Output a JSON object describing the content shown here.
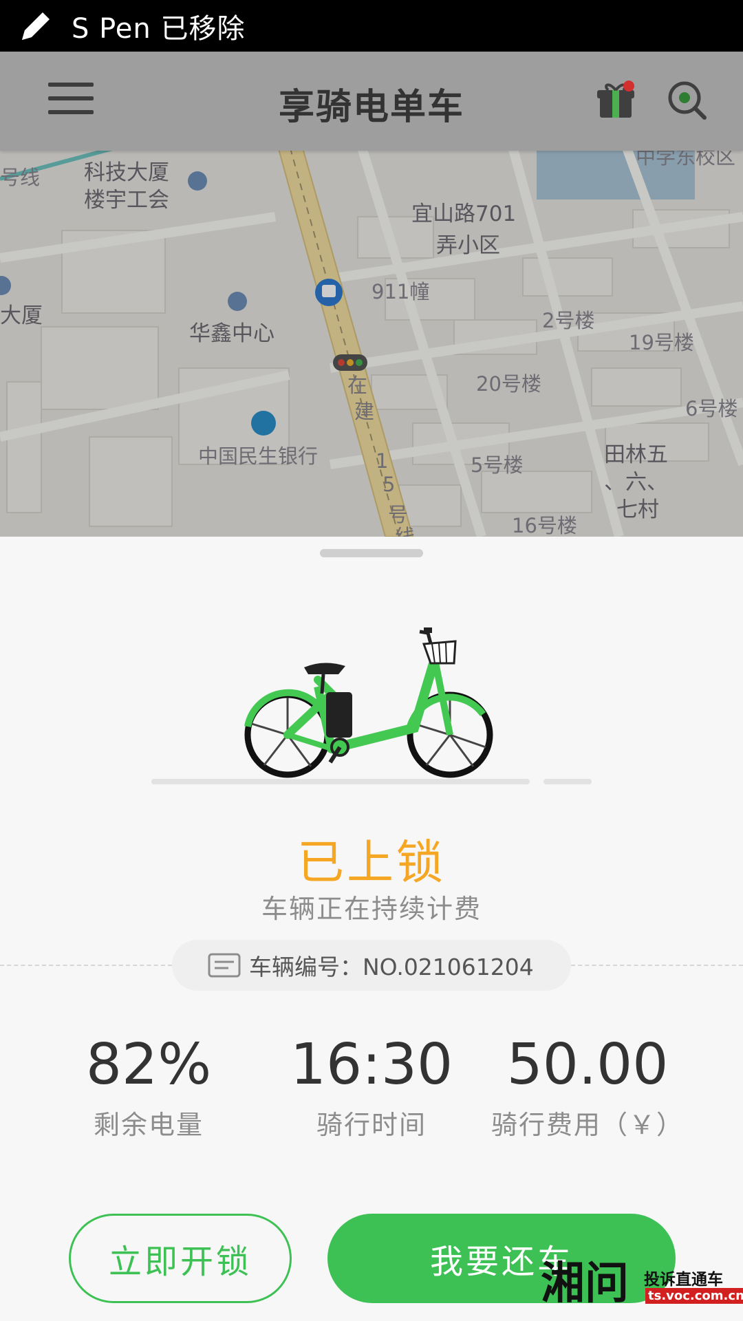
{
  "status_bar": {
    "text": "S Pen 已移除",
    "icon": "pen-icon"
  },
  "header": {
    "title": "享骑电单车",
    "menu_icon": "menu-icon",
    "gift_icon": "gift-icon",
    "scan_icon": "scan-icon"
  },
  "map": {
    "labels": [
      "科技大厦",
      "楼宇工会",
      "号线",
      "大厦",
      "华鑫中心",
      "中国民生银行",
      "宜山路701",
      "弄小区",
      "911幢",
      "2号楼",
      "19号楼",
      "20号楼",
      "6号楼",
      "5号楼",
      "田林五",
      "、六、",
      "七村",
      "16号楼",
      "在",
      "建",
      "1",
      "5",
      "号",
      "线",
      "中学东校区"
    ]
  },
  "sheet": {
    "lock_status": "已上锁",
    "billing_note": "车辆正在持续计费",
    "vehicle_no": "车辆编号：NO.021061204",
    "stats": [
      {
        "value": "82%",
        "label": "剩余电量"
      },
      {
        "value": "16:30",
        "label": "骑行时间"
      },
      {
        "value": "50.00",
        "label": "骑行费用（￥）"
      }
    ],
    "unlock_label": "立即开锁",
    "return_label": "我要还车"
  },
  "watermark": {
    "big": "湘问",
    "line1": "投诉直通车",
    "line2": "ts.voc.com.cn"
  },
  "colors": {
    "accent": "#3ec154",
    "status": "#f5a623",
    "text": "#333333"
  }
}
